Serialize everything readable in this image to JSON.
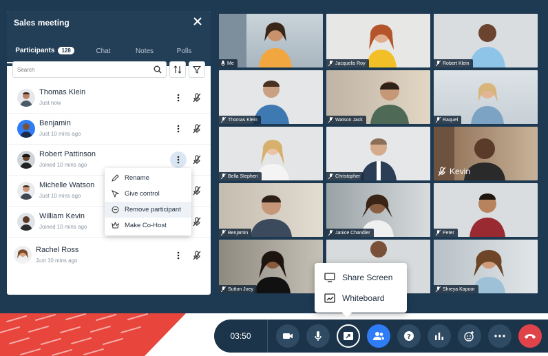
{
  "panel": {
    "title": "Sales meeting",
    "tabs": [
      {
        "label": "Participants",
        "badge": "128",
        "active": true
      },
      {
        "label": "Chat"
      },
      {
        "label": "Notes"
      },
      {
        "label": "Polls"
      }
    ],
    "search_placeholder": "Search"
  },
  "participants": [
    {
      "name": "Thomas Klein",
      "status": "Just now"
    },
    {
      "name": "Benjamin",
      "status": "Just 10 mins ago"
    },
    {
      "name": "Robert Pattinson",
      "status": "Joined 10 mins ago"
    },
    {
      "name": "Michelle Watson",
      "status": "Just 10 mins ago"
    },
    {
      "name": "William Kevin",
      "status": "Joined 10 mins ago"
    },
    {
      "name": "Rachel Ross",
      "status": "Just 10 mins ago"
    }
  ],
  "context_menu": [
    "Rename",
    "Give control",
    "Remove participant",
    "Make Co-Host"
  ],
  "tiles": [
    "Me",
    "Jacquelis Roy",
    "Robert Klein",
    "Thomas Klein",
    "Watson Jack",
    "Raquel",
    "Bella Stephen",
    "Christopher",
    "Kevin",
    "Benjamin",
    "Janice Chandler",
    "Peter",
    "Sutton Joey",
    "",
    "Shreya Kapoor"
  ],
  "share_menu": [
    "Share Screen",
    "Whiteboard"
  ],
  "toolbar": {
    "timer": "03:50"
  },
  "colors": {
    "accent": "#2f7df6",
    "danger": "#e0444a",
    "panel_header": "#233e57",
    "toolbar": "#1c344a"
  }
}
